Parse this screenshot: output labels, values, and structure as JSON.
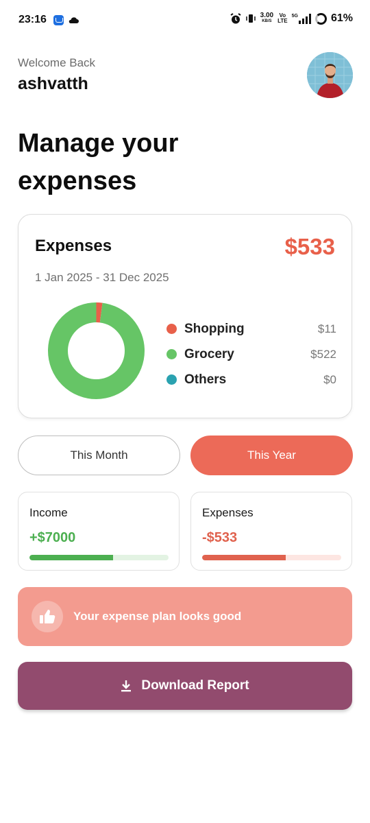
{
  "status_bar": {
    "time": "23:16",
    "speed": "3.00",
    "speed_unit": "KB/S",
    "network_top": "Vo",
    "network_bottom": "LTE",
    "signal_label": "5G",
    "battery": "61%"
  },
  "header": {
    "welcome": "Welcome Back",
    "username": "ashvatth"
  },
  "headline": "Manage your expenses",
  "summary_card": {
    "title": "Expenses",
    "total": "$533",
    "date_range": "1 Jan 2025 - 31 Dec 2025",
    "legend": [
      {
        "label": "Shopping",
        "value": "$11",
        "amount": 11,
        "color": "#e8604a"
      },
      {
        "label": "Grocery",
        "value": "$522",
        "amount": 522,
        "color": "#66c566"
      },
      {
        "label": "Others",
        "value": "$0",
        "amount": 0,
        "color": "#2aa2b0"
      }
    ]
  },
  "period_toggle": {
    "month_label": "This Month",
    "year_label": "This Year",
    "selected": "This Year"
  },
  "stats": {
    "income": {
      "label": "Income",
      "value": "+$7000",
      "color": "#4caf50",
      "track_color": "#e3f3e3",
      "progress": 0.6
    },
    "expenses": {
      "label": "Expenses",
      "value": "-$533",
      "color": "#e0624e",
      "track_color": "#fde6e2",
      "progress": 0.6
    }
  },
  "banner": {
    "text": "Your expense plan looks good",
    "icon": "thumbs-up-icon"
  },
  "download": {
    "label": "Download Report",
    "icon": "download-icon"
  },
  "colors": {
    "accent": "#ec6a58",
    "banner": "#f39b8f",
    "download": "#924b6e"
  }
}
